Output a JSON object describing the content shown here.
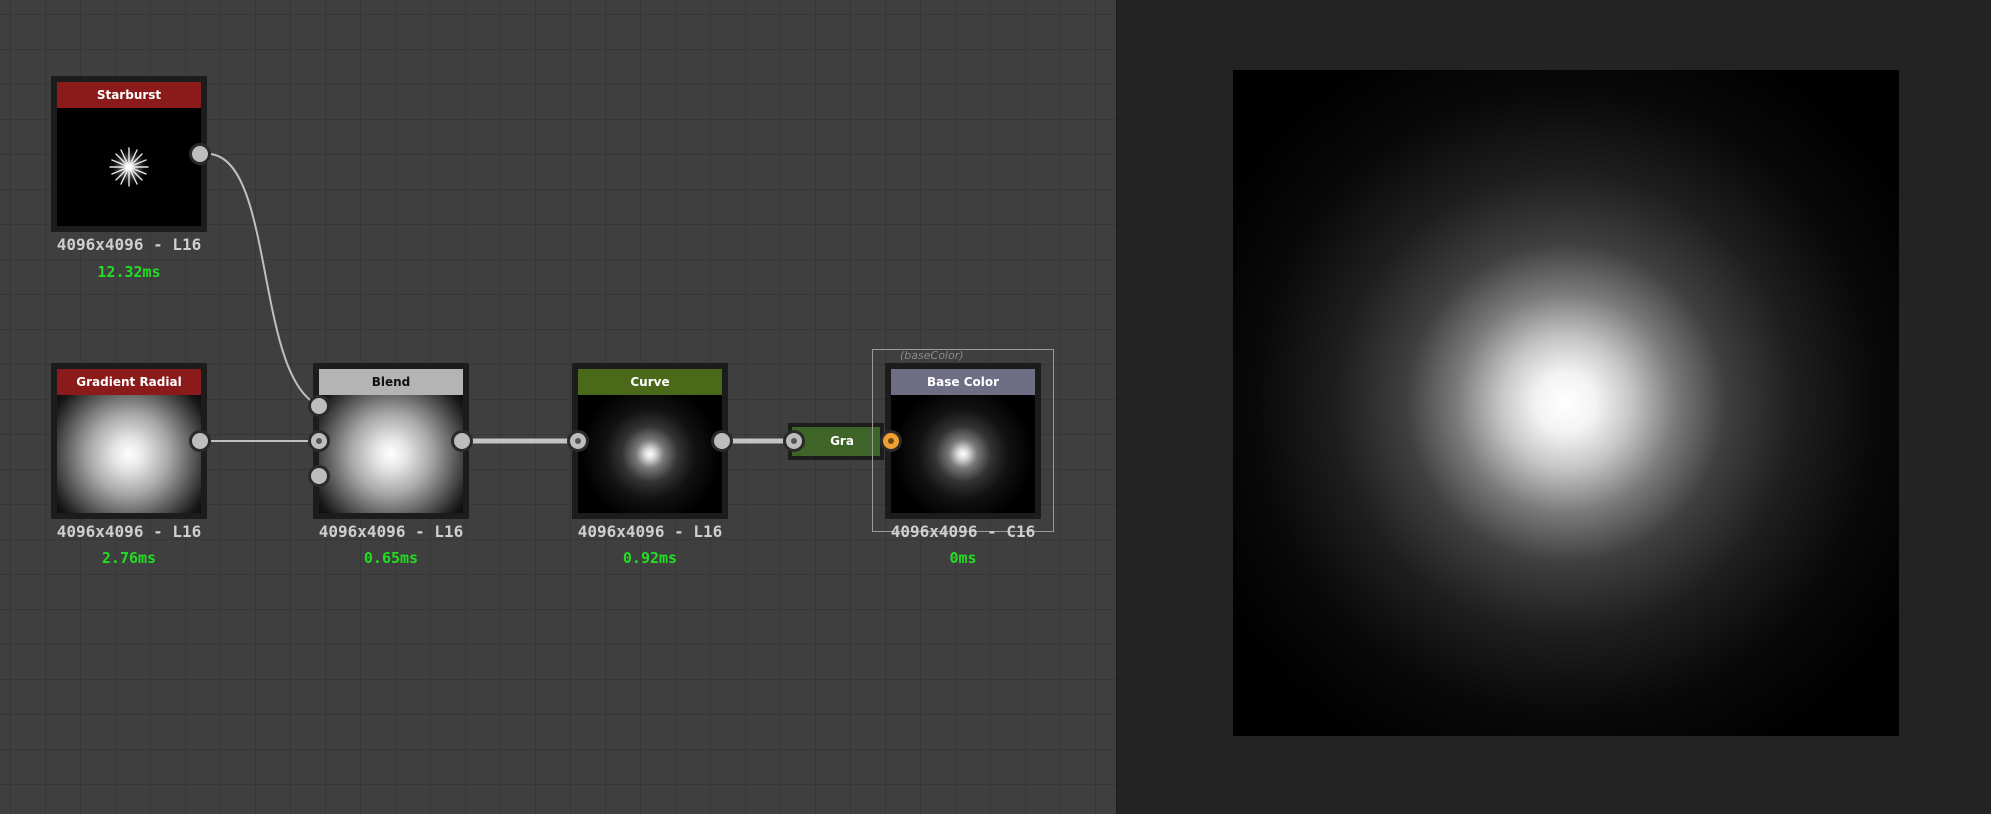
{
  "graph": {
    "nodes": [
      {
        "id": "starburst",
        "title": "Starburst",
        "header_color": "#8b1a1a",
        "resolution": "4096x4096 - L16",
        "time": "12.32ms"
      },
      {
        "id": "gradient_radial",
        "title": "Gradient Radial",
        "header_color": "#8b1a1a",
        "resolution": "4096x4096 - L16",
        "time": "2.76ms"
      },
      {
        "id": "blend",
        "title": "Blend",
        "header_color": "#b4b4b4",
        "resolution": "4096x4096 - L16",
        "time": "0.65ms"
      },
      {
        "id": "curve",
        "title": "Curve",
        "header_color": "#4a6a1a",
        "resolution": "4096x4096 - L16",
        "time": "0.92ms"
      },
      {
        "id": "base_color",
        "title": "Base Color",
        "header_color": "#6e6e84",
        "resolution": "4096x4096 - C16",
        "time": "0ms"
      }
    ],
    "mini_node": {
      "label": "Gra",
      "color": "#3e6427"
    },
    "frame_label": "(baseColor)"
  },
  "colors": {
    "graph_background": "#3f3f3f",
    "preview_background": "#232323",
    "time_text": "#22dd22",
    "wire": "#bfbfbf",
    "output_port": "#f0a030"
  }
}
